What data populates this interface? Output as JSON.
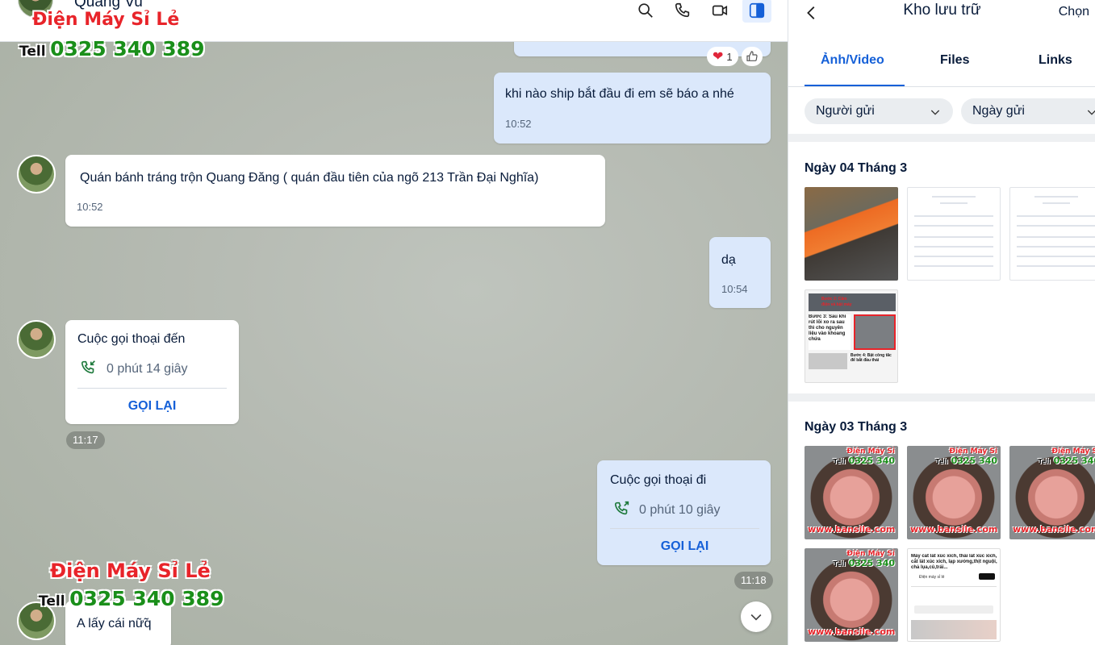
{
  "colors": {
    "accent": "#1560d8",
    "outgoing_bubble": "#dbe8fb",
    "incoming_bubble": "#ffffff",
    "watermark_red": "#e8242a",
    "watermark_green": "#1a8f1a"
  },
  "chat_header": {
    "contact_name": "Quang Vu",
    "icons": [
      "search-icon",
      "phone-icon",
      "video-call-icon",
      "sidebar-toggle-icon"
    ]
  },
  "watermark": {
    "title": "Điện Máy Sỉ Lẻ",
    "tell_label": "Tell",
    "phone": "0325 340 389"
  },
  "reactions": {
    "heart_icon": "❤",
    "count": "1",
    "like_icon": "like-icon"
  },
  "messages": [
    {
      "direction": "out",
      "text": "khi nào ship bắt đầu đi em sẽ báo a nhé",
      "time": "10:52"
    },
    {
      "direction": "in",
      "text": "Quán bánh tráng trộn Quang Đăng ( quán đầu tiên của ngõ 213 Trần Đại Nghĩa)",
      "time": "10:52"
    },
    {
      "direction": "out",
      "text": "dạ",
      "time": "10:54"
    },
    {
      "direction": "in",
      "type": "call",
      "title": "Cuộc gọi thoại đến",
      "duration": "0 phút 14 giây",
      "action": "GỌI LẠI",
      "time": "11:17"
    },
    {
      "direction": "out",
      "type": "call",
      "title": "Cuộc gọi thoại đi",
      "duration": "0 phút 10 giây",
      "action": "GỌI LẠI",
      "time": "11:18"
    },
    {
      "direction": "in",
      "text": "A lấy cái nữ̃q"
    }
  ],
  "panel": {
    "title": "Kho lưu trữ",
    "select_label": "Chọn",
    "tabs": [
      "Ảnh/Video",
      "Files",
      "Links"
    ],
    "active_tab": "Ảnh/Video",
    "filters": [
      "Người gửi",
      "Ngày gửi"
    ],
    "groups": [
      {
        "date": "Ngày 04 Tháng 3"
      },
      {
        "date": "Ngày 03 Tháng 3"
      }
    ],
    "thumb_watermark": {
      "title": "Điện Máy Sỉ",
      "tell": "Tell",
      "phone_part": "0325 340",
      "url": "www.bansile.com"
    },
    "guide_thumb": {
      "step2": "Bước 2: Cắm điện và bật máy",
      "step3": "Bước 3: Sau khi rút lõi xo ra sau thì cho nguyên liệu vào khoang chứa",
      "step4": "Bước 4: Bật công tắc để bắt đầu thái"
    },
    "web_thumb": {
      "headline": "Máy cắt lát xúc xích, thái lát xúc xích, cắt lát xúc xích, lạp xưởng,thịt nguội, chả lụa,củ,trái...",
      "shop": "Điện máy sỉ lẻ"
    }
  }
}
